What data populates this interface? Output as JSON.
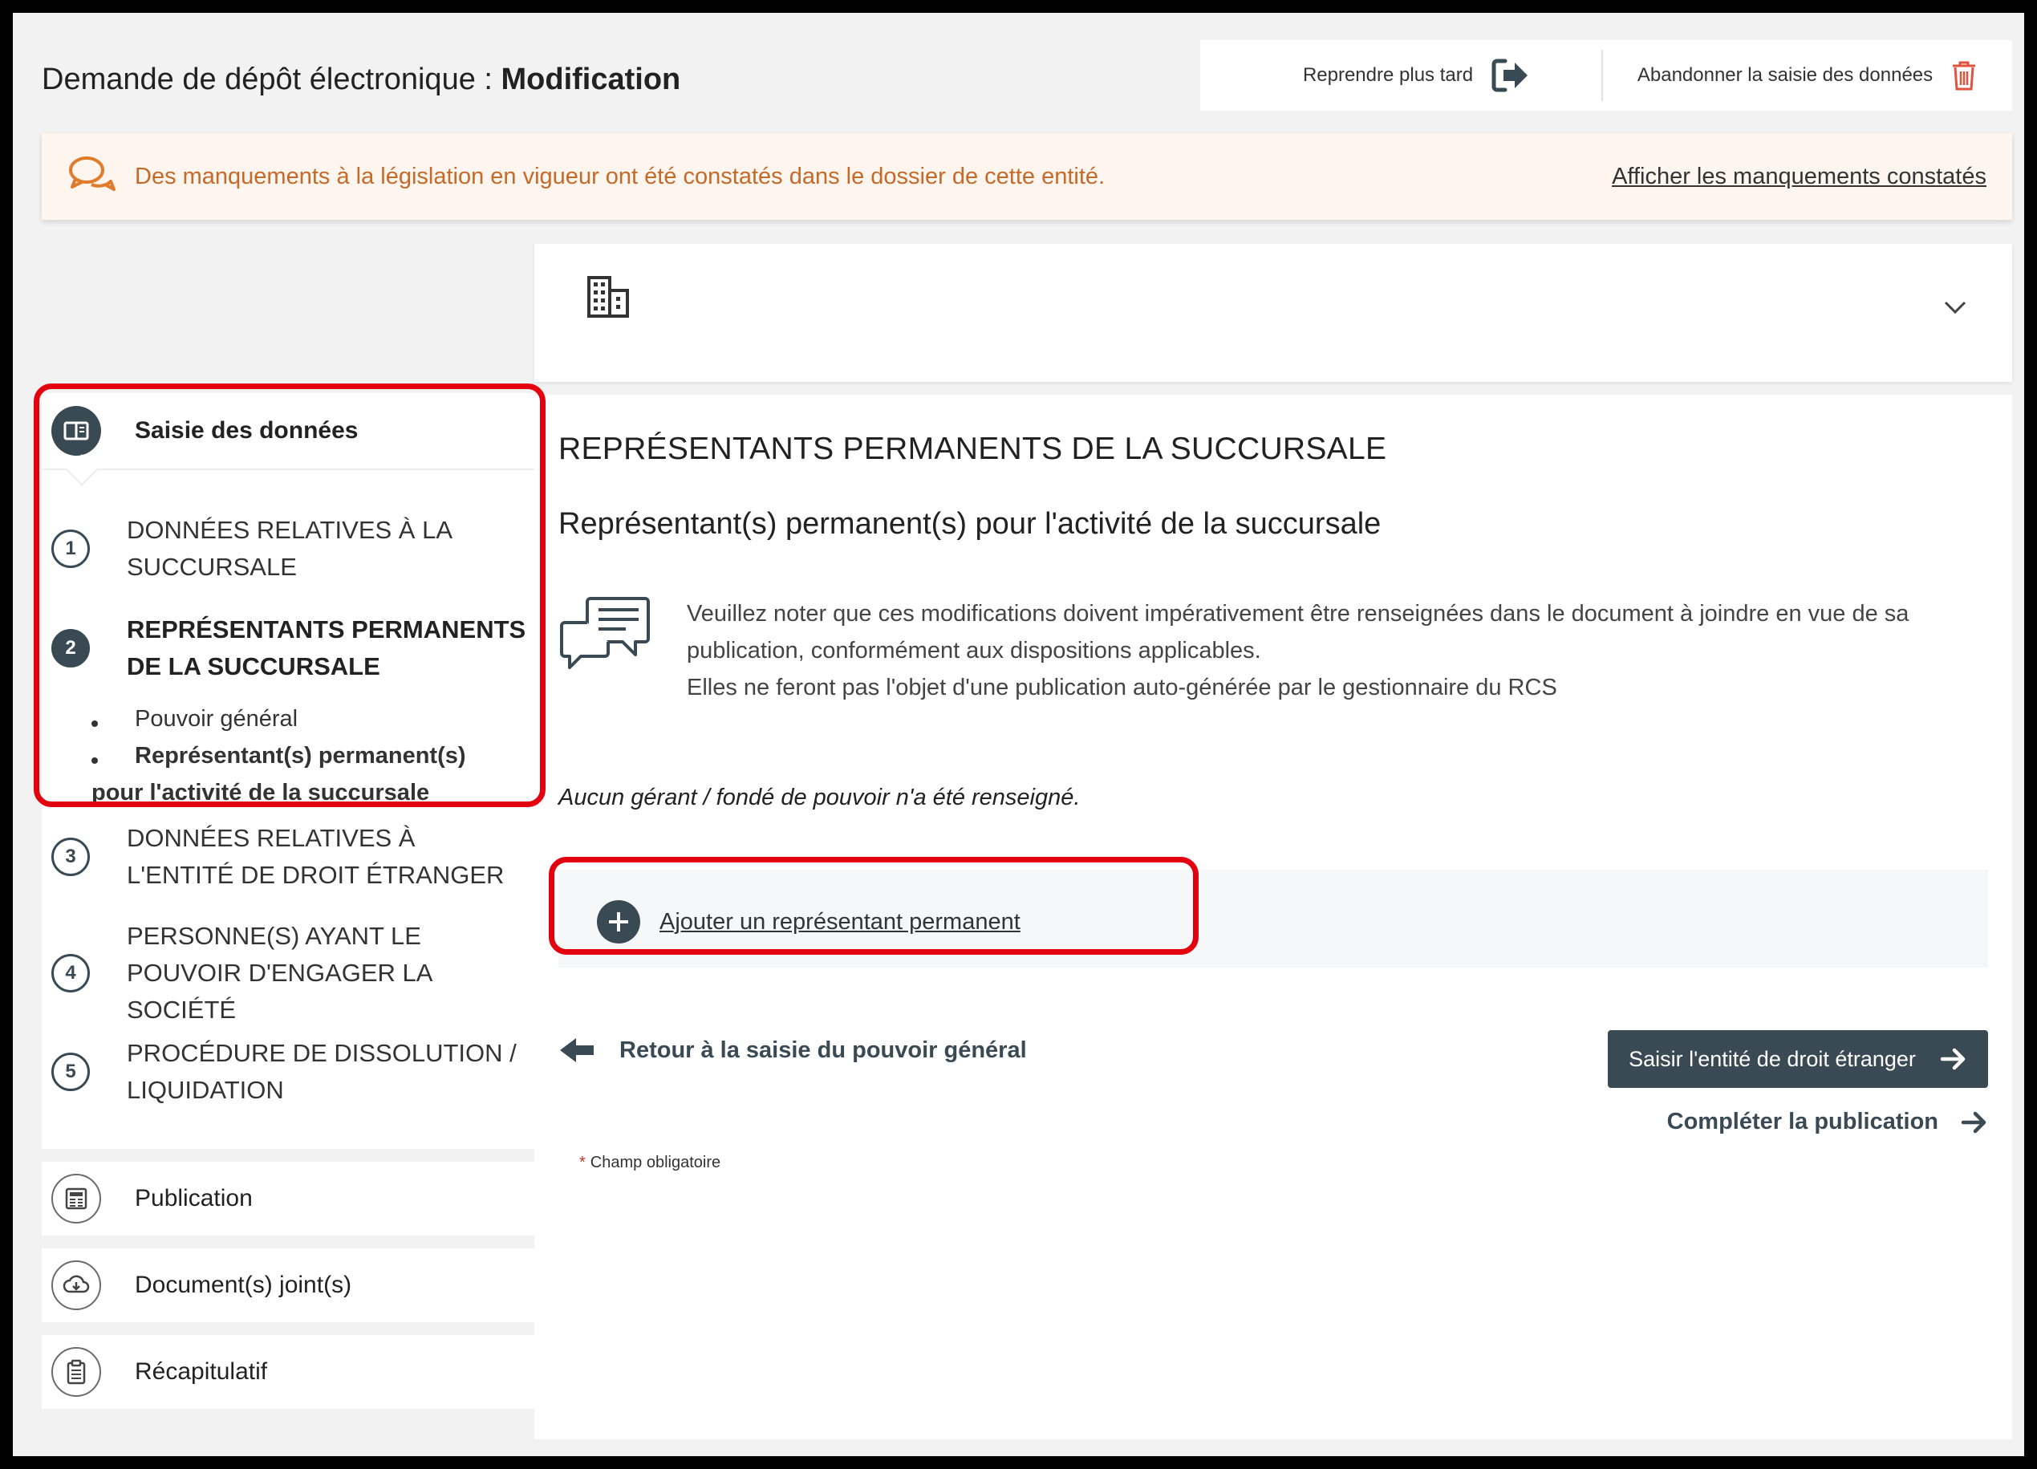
{
  "header": {
    "title_prefix": "Demande de dépôt électronique : ",
    "title_bold": "Modification",
    "resume_label": "Reprendre plus tard",
    "abandon_label": "Abandonner la saisie des données"
  },
  "alert": {
    "text": "Des manquements à la législation en vigueur ont été constatés dans le dossier de cette entité.",
    "link": "Afficher les manquements constatés",
    "color": "#c46a2a"
  },
  "sidebar": {
    "data_entry_label": "Saisie des données",
    "steps": [
      {
        "number": "1",
        "label": "DONNÉES RELATIVES À LA SUCCURSALE"
      },
      {
        "number": "2",
        "label": "REPRÉSENTANTS PERMANENTS DE LA SUCCURSALE"
      },
      {
        "number": "3",
        "label": "DONNÉES RELATIVES À L'ENTITÉ DE DROIT ÉTRANGER"
      },
      {
        "number": "4",
        "label": "PERSONNE(S) AYANT LE POUVOIR D'ENGAGER LA SOCIÉTÉ"
      },
      {
        "number": "5",
        "label": "PROCÉDURE DE DISSOLUTION / LIQUIDATION"
      }
    ],
    "substeps": [
      {
        "label": "Pouvoir général"
      },
      {
        "label": "Représentant(s) permanent(s)",
        "label_cont": "pour l'activité de la succursale"
      }
    ],
    "links": [
      {
        "label": "Publication",
        "icon": "newspaper-icon"
      },
      {
        "label": "Document(s) joint(s)",
        "icon": "cloud-download-icon"
      },
      {
        "label": "Récapitulatif",
        "icon": "clipboard-icon"
      }
    ]
  },
  "main": {
    "section_title": "REPRÉSENTANTS PERMANENTS DE LA SUCCURSALE",
    "section_subtitle": "Représentant(s) permanent(s) pour l'activité de la succursale",
    "note_lines": [
      "Veuillez noter que ces modifications doivent impérativement être renseignées dans le document à joindre en vue de sa",
      "publication, conformément aux dispositions applicables.",
      "Elles ne feront pas l'objet d'une publication auto-générée par le gestionnaire du RCS"
    ],
    "empty_text": "Aucun gérant / fondé de pouvoir n'a été renseigné.",
    "add_label": "Ajouter un représentant permanent",
    "back_label": "Retour à la saisie du pouvoir général",
    "next_label": "Saisir l'entité de droit étranger",
    "complete_label": "Compléter la publication",
    "required_star": "*",
    "required_label": "Champ obligatoire"
  },
  "colors": {
    "accent": "#3a4a54",
    "highlight": "#e3000f",
    "alert_bg": "#fdf5ee"
  }
}
